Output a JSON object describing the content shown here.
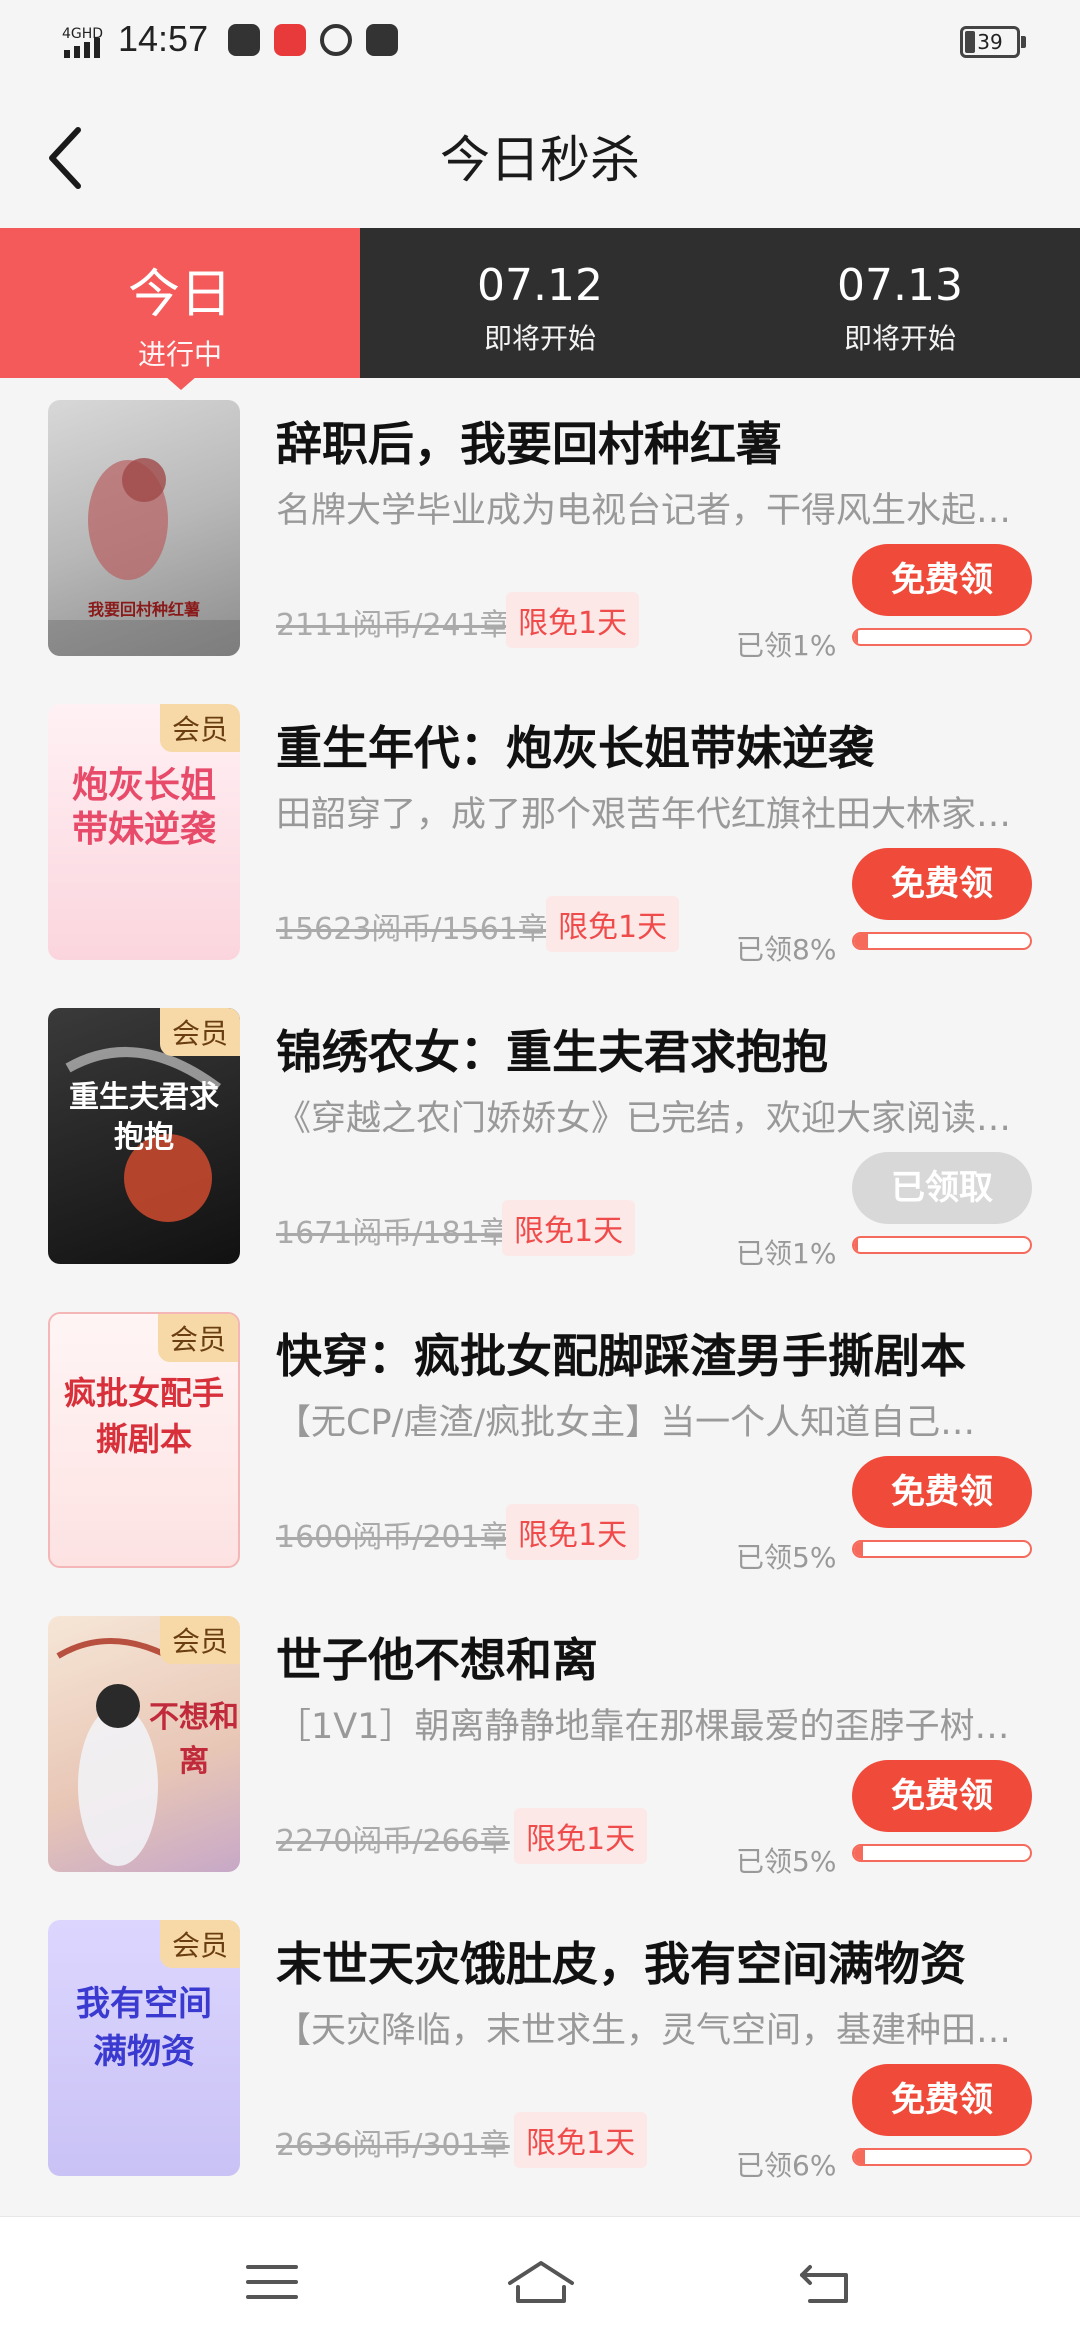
{
  "status_bar": {
    "network": "4GHD",
    "time": "14:57",
    "battery": "39"
  },
  "header": {
    "title": "今日秒杀"
  },
  "tabs": [
    {
      "main": "今日",
      "sub": "进行中"
    },
    {
      "main": "07.12",
      "sub": "即将开始"
    },
    {
      "main": "07.13",
      "sub": "即将开始"
    }
  ],
  "books": [
    {
      "title": "辞职后，我要回村种红薯",
      "desc": "名牌大学毕业成为电视台记者，干得风生水起…",
      "price": "2111阅币/241章",
      "tag": "限免1天",
      "button": "免费领",
      "claimed": "已领1%",
      "progress": 0.01,
      "vip": "",
      "cover_text": "我要回村种红薯",
      "active": true
    },
    {
      "title": "重生年代：炮灰长姐带妹逆袭",
      "desc": "田韶穿了，成了那个艰苦年代红旗社田大林家…",
      "price": "15623阅币/1561章",
      "tag": "限免1天",
      "button": "免费领",
      "claimed": "已领8%",
      "progress": 0.08,
      "vip": "会员",
      "cover_text": "炮灰长姐带妹逆袭",
      "active": true
    },
    {
      "title": "锦绣农女：重生夫君求抱抱",
      "desc": "《穿越之农门娇娇女》已完结，欢迎大家阅读…",
      "price": "1671阅币/181章",
      "tag": "限免1天",
      "button": "已领取",
      "claimed": "已领1%",
      "progress": 0.01,
      "vip": "会员",
      "cover_text": "重生夫君求抱抱",
      "active": false
    },
    {
      "title": "快穿：疯批女配脚踩渣男手撕剧本",
      "desc": "【无CP/虐渣/疯批女主】当一个人知道自己…",
      "price": "1600阅币/201章",
      "tag": "限免1天",
      "button": "免费领",
      "claimed": "已领5%",
      "progress": 0.05,
      "vip": "会员",
      "cover_text": "疯批女配手撕剧本",
      "active": true
    },
    {
      "title": "世子他不想和离",
      "desc": "［1V1］朝离静静地靠在那棵最爱的歪脖子树…",
      "price": "2270阅币/266章",
      "tag": "限免1天",
      "button": "免费领",
      "claimed": "已领5%",
      "progress": 0.05,
      "vip": "会员",
      "cover_text": "不想和离",
      "active": true
    },
    {
      "title": "末世天灾饿肚皮，我有空间满物资",
      "desc": "【天灾降临，末世求生，灵气空间，基建种田…",
      "price": "2636阅币/301章",
      "tag": "限免1天",
      "button": "免费领",
      "claimed": "已领6%",
      "progress": 0.06,
      "vip": "会员",
      "cover_text": "我有空间满物资",
      "active": true
    }
  ],
  "colors": {
    "accent": "#f45a59",
    "button": "#f04b3a",
    "tab_bg": "#2f2f2f"
  }
}
